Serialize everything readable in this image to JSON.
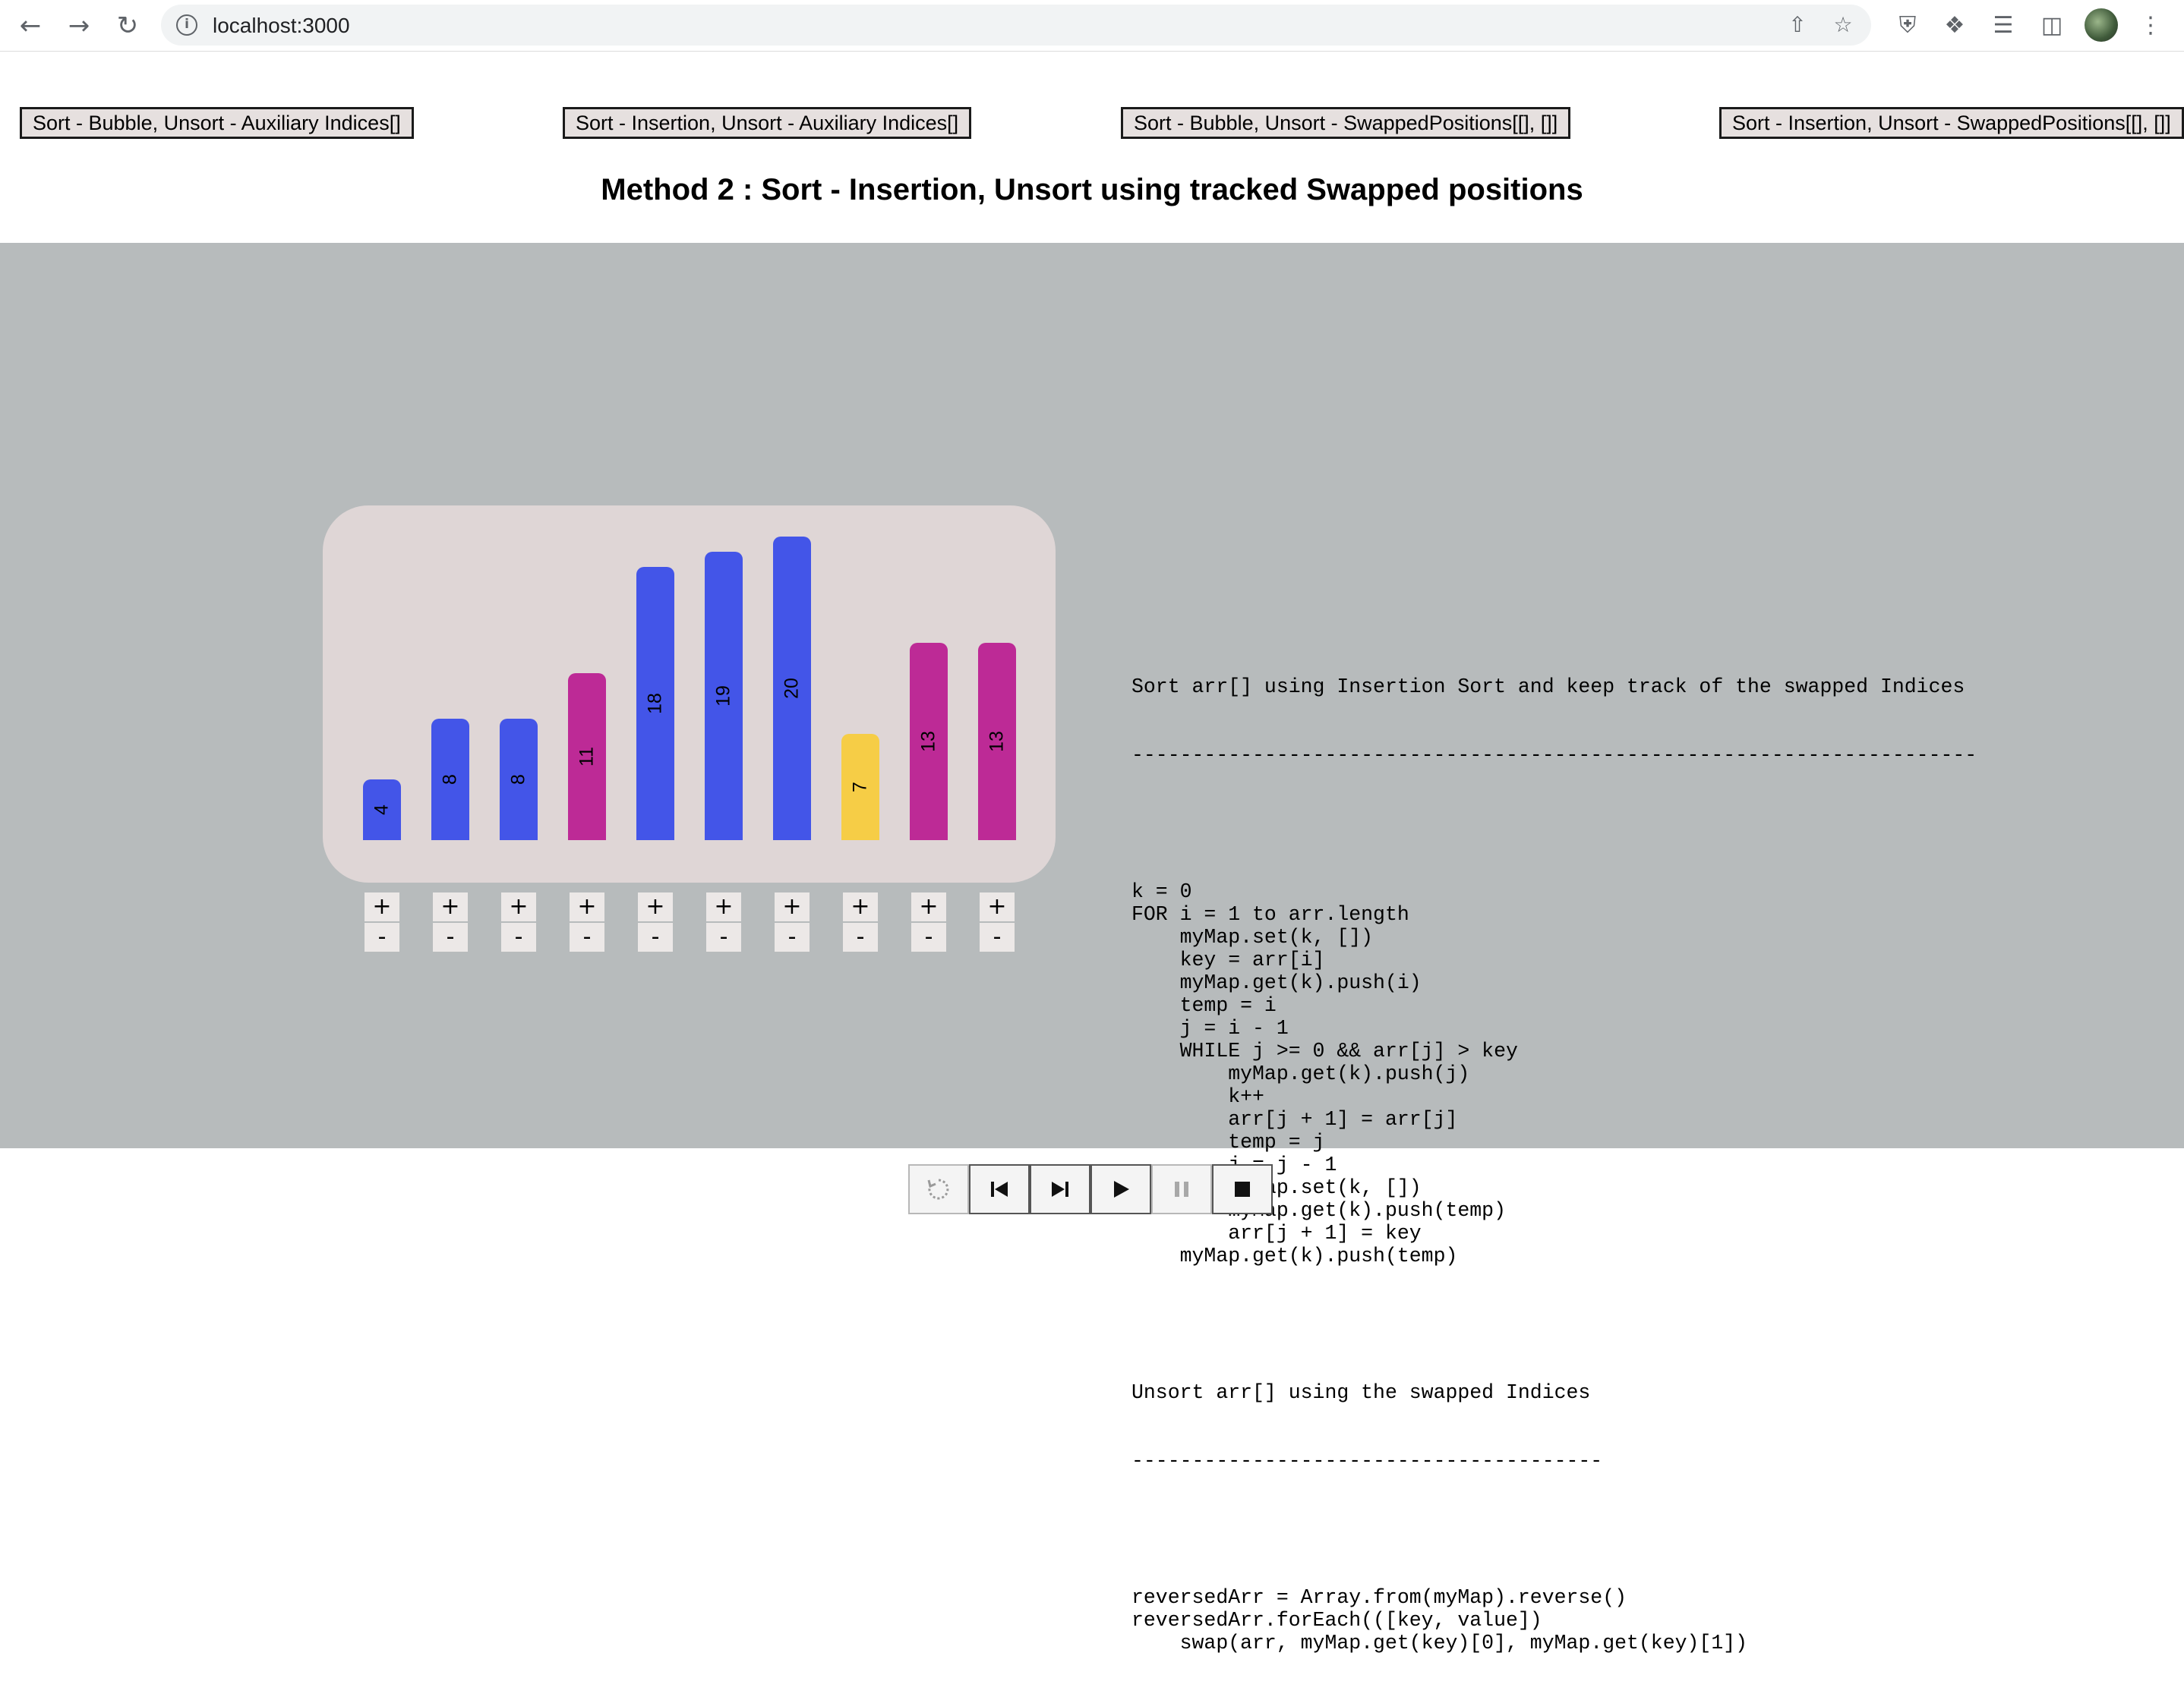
{
  "browser": {
    "url": "localhost:3000"
  },
  "algorithm_buttons": [
    "Sort - Bubble, Unsort - Auxiliary Indices[]",
    "Sort - Insertion, Unsort - Auxiliary Indices[]",
    "Sort - Bubble, Unsort - SwappedPositions[[], []]",
    "Sort - Insertion, Unsort - SwappedPositions[[], []]"
  ],
  "page_title": "Method 2 : Sort - Insertion, Unsort using tracked Swapped positions",
  "colors": {
    "blue": "#4355e8",
    "magenta": "#bd2a96",
    "yellow": "#f6cd46",
    "stage_bg": "#b7bbbc",
    "chart_bg": "#dfd6d6"
  },
  "bars": {
    "values": [
      4,
      8,
      8,
      11,
      18,
      19,
      20,
      7,
      13,
      13
    ],
    "labels": [
      "4",
      "8",
      "8",
      "11",
      "18",
      "19",
      "20",
      "7",
      "13",
      "13"
    ],
    "states": [
      "blue",
      "blue",
      "blue",
      "magenta",
      "blue",
      "blue",
      "blue",
      "yellow",
      "magenta",
      "magenta"
    ],
    "max": 20,
    "increment_label": "+",
    "decrement_label": "-"
  },
  "code": {
    "sort_heading": "Sort arr[] using Insertion Sort and keep track of the swapped Indices",
    "sort_rule": "----------------------------------------------------------------------",
    "sort_lines": [
      "k = 0",
      "FOR i = 1 to arr.length",
      "    myMap.set(k, [])",
      "    key = arr[i]",
      "    myMap.get(k).push(i)",
      "    temp = i",
      "    j = i - 1",
      "    WHILE j >= 0 && arr[j] > key",
      "        myMap.get(k).push(j)",
      "        k++",
      "        arr[j + 1] = arr[j]",
      "        temp = j",
      "        j = j - 1",
      "        myMap.set(k, [])",
      "        myMap.get(k).push(temp)",
      "        arr[j + 1] = key",
      "    myMap.get(k).push(temp)"
    ],
    "unsort_heading": "Unsort arr[] using the swapped Indices",
    "unsort_rule": "---------------------------------------",
    "unsort_lines": [
      "reversedArr = Array.from(myMap).reverse()",
      "reversedArr.forEach(([key, value])",
      "    swap(arr, myMap.get(key)[0], myMap.get(key)[1])"
    ]
  },
  "controls": [
    "replay-icon",
    "skip-back-icon",
    "step-forward-icon",
    "play-icon",
    "pause-icon",
    "stop-icon"
  ]
}
